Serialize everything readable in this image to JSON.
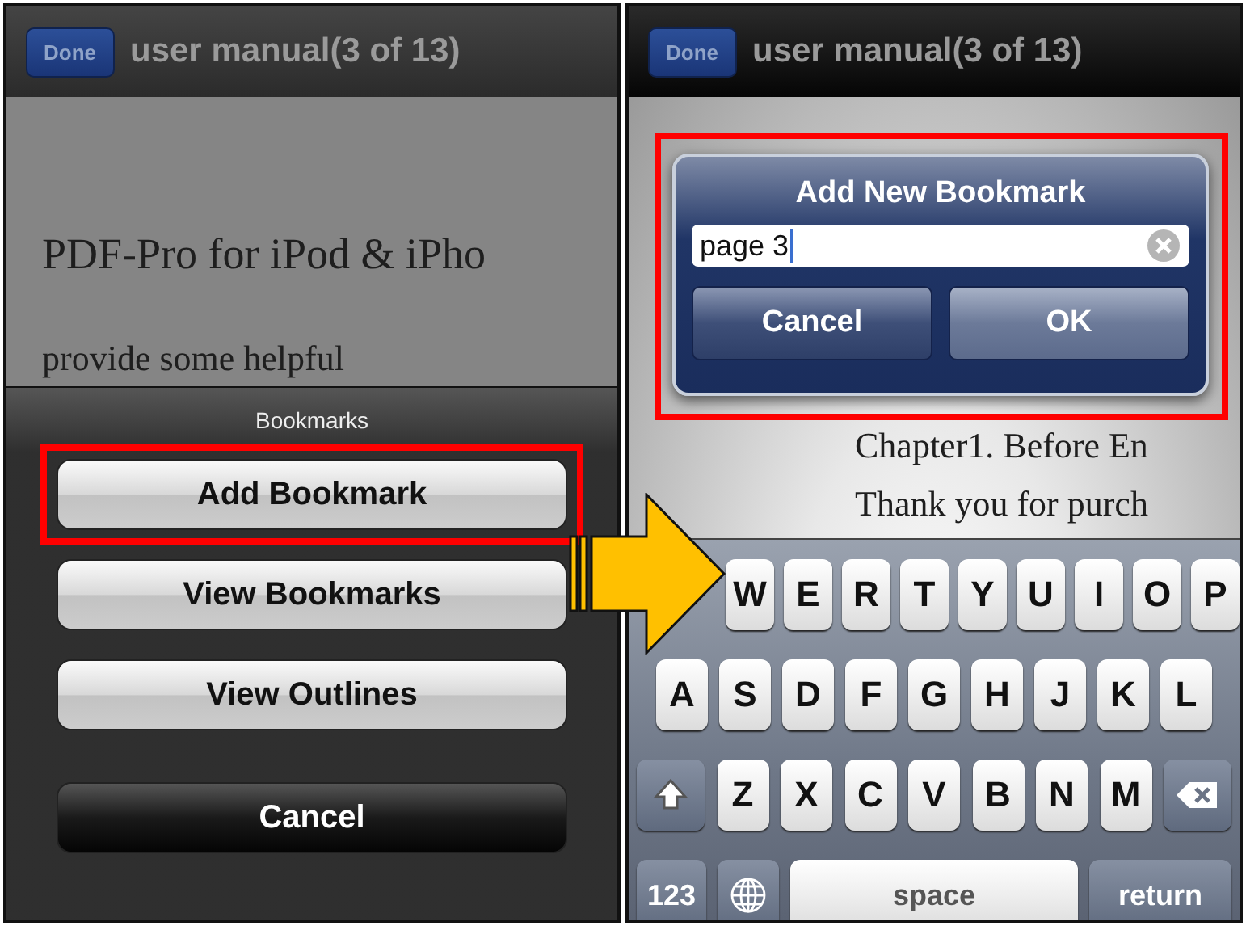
{
  "left_screen": {
    "nav": {
      "done": "Done",
      "title": "user manual(3 of 13)"
    },
    "document_lines": [
      "PDF-Pro for iPod & iPho",
      "provide some helpful"
    ],
    "action_sheet": {
      "title": "Bookmarks",
      "buttons": [
        {
          "label": "Add Bookmark",
          "kind": "default",
          "highlighted": true
        },
        {
          "label": "View Bookmarks",
          "kind": "default",
          "highlighted": false
        },
        {
          "label": "View Outlines",
          "kind": "default",
          "highlighted": false
        },
        {
          "label": "Cancel",
          "kind": "cancel",
          "highlighted": false
        }
      ]
    }
  },
  "right_screen": {
    "nav": {
      "done": "Done",
      "title": "user manual(3 of 13)"
    },
    "document_lines": [
      "Chapter1. Before En",
      "Thank you for purch"
    ],
    "alert": {
      "title": "Add New Bookmark",
      "highlighted": true,
      "field": {
        "value": "page 3"
      },
      "buttons": [
        {
          "label": "Cancel",
          "kind": "cancel"
        },
        {
          "label": "OK",
          "kind": "default"
        }
      ]
    },
    "keyboard": {
      "rows": [
        {
          "keys": [
            {
              "kind": "letter",
              "label": "W"
            },
            {
              "kind": "letter",
              "label": "E"
            },
            {
              "kind": "letter",
              "label": "R"
            },
            {
              "kind": "letter",
              "label": "T"
            },
            {
              "kind": "letter",
              "label": "Y"
            },
            {
              "kind": "letter",
              "label": "U"
            },
            {
              "kind": "letter",
              "label": "I"
            },
            {
              "kind": "letter",
              "label": "O"
            },
            {
              "kind": "letter",
              "label": "P"
            }
          ]
        },
        {
          "keys": [
            {
              "kind": "letter",
              "label": "A"
            },
            {
              "kind": "letter",
              "label": "S"
            },
            {
              "kind": "letter",
              "label": "D"
            },
            {
              "kind": "letter",
              "label": "F"
            },
            {
              "kind": "letter",
              "label": "G"
            },
            {
              "kind": "letter",
              "label": "H"
            },
            {
              "kind": "letter",
              "label": "J"
            },
            {
              "kind": "letter",
              "label": "K"
            },
            {
              "kind": "letter",
              "label": "L"
            }
          ]
        },
        {
          "keys": [
            {
              "kind": "shift"
            },
            {
              "kind": "letter",
              "label": "Z"
            },
            {
              "kind": "letter",
              "label": "X"
            },
            {
              "kind": "letter",
              "label": "C"
            },
            {
              "kind": "letter",
              "label": "V"
            },
            {
              "kind": "letter",
              "label": "B"
            },
            {
              "kind": "letter",
              "label": "N"
            },
            {
              "kind": "letter",
              "label": "M"
            },
            {
              "kind": "delete"
            }
          ]
        },
        {
          "keys": [
            {
              "kind": "numbers",
              "label": "123"
            },
            {
              "kind": "globe"
            },
            {
              "kind": "space",
              "label": "space"
            },
            {
              "kind": "return",
              "label": "return"
            }
          ]
        }
      ]
    }
  }
}
